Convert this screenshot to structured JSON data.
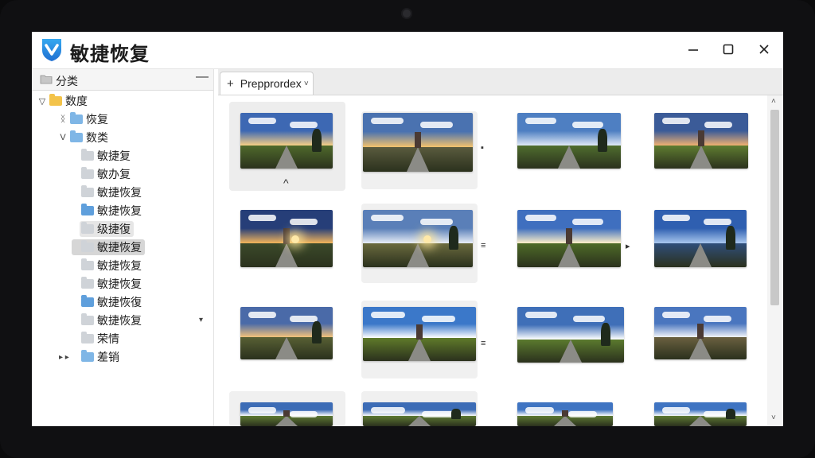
{
  "app": {
    "title": "敏捷恢复"
  },
  "window_controls": {
    "minimize": "—",
    "maximize": "☐",
    "close": "✕"
  },
  "tree": {
    "header_label": "分类",
    "header_collapse": "—",
    "items": [
      {
        "label": "数度",
        "toggle": "▽",
        "color": "yellow"
      },
      {
        "label": "恢复",
        "toggle": "ᛝ",
        "color": "blue"
      },
      {
        "label": "数类",
        "toggle": "V",
        "color": "blue"
      },
      {
        "label": "敏捷复",
        "color": "gray"
      },
      {
        "label": "敏办复",
        "color": "gray"
      },
      {
        "label": "敏捷恢复",
        "color": "gray"
      },
      {
        "label": "敏捷恢复",
        "color": "blue2"
      },
      {
        "label": "级捷復",
        "color": "gray"
      },
      {
        "label": "敏捷恢复",
        "color": "gray"
      },
      {
        "label": "敏捷恢复",
        "color": "gray"
      },
      {
        "label": "敏捷恢复",
        "color": "gray"
      },
      {
        "label": "敏捷恢復",
        "color": "blue2"
      },
      {
        "label": "敏捷恢复",
        "color": "gray"
      },
      {
        "label": "荣情",
        "color": "gray"
      },
      {
        "label": "差销",
        "toggle": "▸ ▸",
        "color": "blue"
      }
    ]
  },
  "tabs": [
    {
      "label": "Prеpprordex",
      "plus": "+",
      "caret": "˅"
    }
  ],
  "thumbnails": [
    {
      "sky": "#3d68b3",
      "accent": "#f6cf85",
      "ground": "#4f6a2b"
    },
    {
      "sky": "#4a72b0",
      "accent": "#f4c36c",
      "ground": "#5a5b3e"
    },
    {
      "sky": "#4e7fc2",
      "accent": "#dfe8f6",
      "ground": "#4f6d2e"
    },
    {
      "sky": "#3b5b98",
      "accent": "#f0b070",
      "ground": "#5f7c30"
    },
    {
      "sky": "#263e78",
      "accent": "#f5b65a",
      "ground": "#3b4a2a"
    },
    {
      "sky": "#5a7fb8",
      "accent": "#e9eef7",
      "ground": "#6a6a3e"
    },
    {
      "sky": "#3f6fbf",
      "accent": "#fff0c8",
      "ground": "#4e6b27"
    },
    {
      "sky": "#2f5fb0",
      "accent": "#a9c7ee",
      "ground": "#2f4f7a"
    },
    {
      "sky": "#4a6aa8",
      "accent": "#f2c27a",
      "ground": "#586034"
    },
    {
      "sky": "#3b78c9",
      "accent": "#ffffff",
      "ground": "#5f7a2a"
    },
    {
      "sky": "#3f6fb8",
      "accent": "#ffffff",
      "ground": "#5b7a2e"
    },
    {
      "sky": "#4a76bf",
      "accent": "#f1f4f9",
      "ground": "#6a6040"
    },
    {
      "sky": "#3c6cb6",
      "accent": "#ffffff",
      "ground": "#5d7a34"
    },
    {
      "sky": "#3c6cb6",
      "accent": "#ffffff",
      "ground": "#5d7a34"
    },
    {
      "sky": "#3f74c2",
      "accent": "#ffffff",
      "ground": "#5d7a34"
    },
    {
      "sky": "#3f74c2",
      "accent": "#ffffff",
      "ground": "#5d7a34"
    }
  ],
  "cell_marks": {
    "first_below": "^"
  },
  "scrollbar": {
    "up": "˄",
    "down": "˅"
  }
}
